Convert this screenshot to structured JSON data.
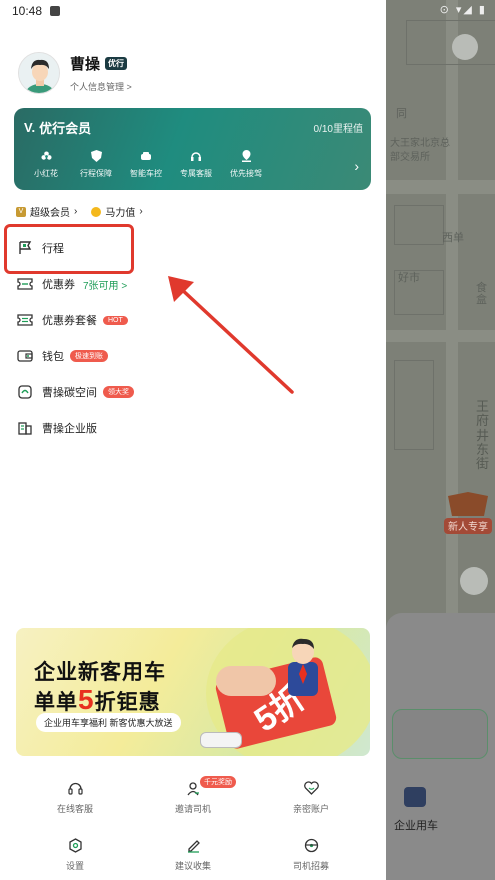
{
  "status_bar": {
    "time": "10:48"
  },
  "profile": {
    "name": "曹操",
    "badge": "优行",
    "link": "个人信息管理 >"
  },
  "member_card": {
    "title": "优行会员",
    "progress": "0/10里程值",
    "perks": [
      {
        "label": "小红花",
        "icon": "flower-icon"
      },
      {
        "label": "行程保障",
        "icon": "shield-icon"
      },
      {
        "label": "智能车控",
        "icon": "car-icon"
      },
      {
        "label": "专属客服",
        "icon": "headset-icon"
      },
      {
        "label": "优先接驾",
        "icon": "pin-icon"
      }
    ],
    "more_icon": "chevron-right-icon"
  },
  "sub_row": {
    "super_member": "超级会员",
    "mali": "马力值"
  },
  "menu": [
    {
      "label": "行程",
      "icon": "flag-icon",
      "sub": "",
      "tag": ""
    },
    {
      "label": "优惠券",
      "icon": "coupon-icon",
      "sub": "7张可用 >",
      "tag": ""
    },
    {
      "label": "优惠券套餐",
      "icon": "coupon-pack-icon",
      "sub": "",
      "tag": "HOT"
    },
    {
      "label": "钱包",
      "icon": "wallet-icon",
      "sub": "",
      "tag": "极速到账"
    },
    {
      "label": "曹操碳空间",
      "icon": "carbon-icon",
      "sub": "",
      "tag": "领大奖"
    },
    {
      "label": "曹操企业版",
      "icon": "enterprise-icon",
      "sub": "",
      "tag": ""
    }
  ],
  "banner": {
    "line1": "企业新客用车",
    "line2_a": "单单",
    "line2_num": "5",
    "line2_b": "折钜惠",
    "sub": "企业用车享福利 新客优惠大放送",
    "ticket_text": "5折"
  },
  "bottom_grid": [
    {
      "label": "在线客服",
      "icon": "headset-icon",
      "badge": ""
    },
    {
      "label": "邀请司机",
      "icon": "invite-icon",
      "badge": "千元奖励"
    },
    {
      "label": "亲密账户",
      "icon": "heart-icon",
      "badge": ""
    },
    {
      "label": "设置",
      "icon": "settings-icon",
      "badge": ""
    },
    {
      "label": "建议收集",
      "icon": "pen-icon",
      "badge": ""
    },
    {
      "label": "司机招募",
      "icon": "steering-icon",
      "badge": ""
    }
  ],
  "map": {
    "labels": [
      "同",
      "大王家北京总",
      "部交易所",
      "西单",
      "好市",
      "食盒",
      "王府井东街"
    ],
    "new_user_badge": "新人专享",
    "enterprise_label": "企业用车"
  },
  "colors": {
    "accent_green": "#1f9d58",
    "member_card": "#1f8c7f",
    "highlight_red": "#e0392d",
    "tag_red": "#ef5b4d"
  }
}
